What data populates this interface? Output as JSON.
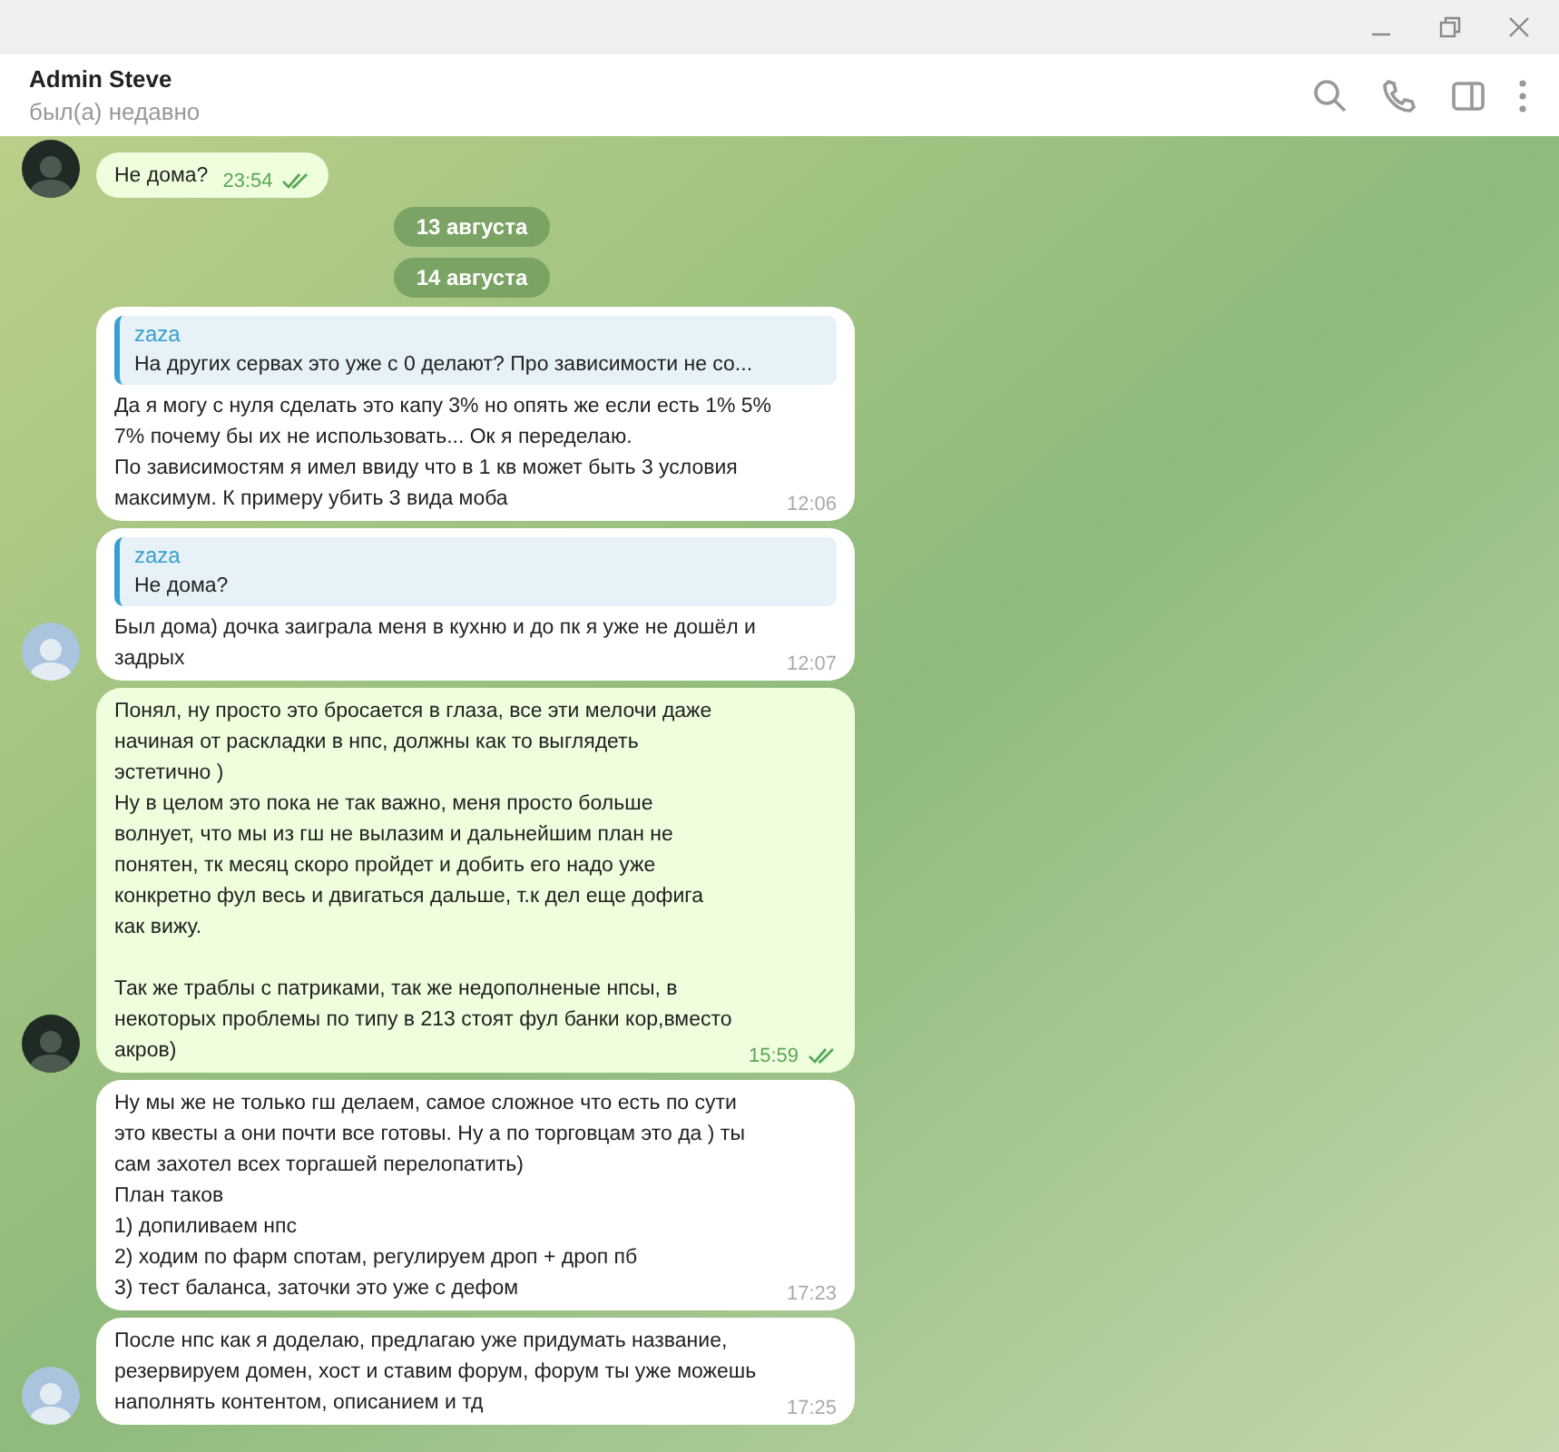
{
  "header": {
    "name": "Admin Steve",
    "status": "был(а) недавно"
  },
  "messages": [
    {
      "kind": "message",
      "outgoing": true,
      "avatar": true,
      "text": "Не дома?",
      "time": "23:54",
      "read": true
    },
    {
      "kind": "date",
      "text": "13 августа"
    },
    {
      "kind": "date",
      "text": "14 августа"
    },
    {
      "kind": "message",
      "outgoing": false,
      "avatar": false,
      "reply": {
        "author": "zaza",
        "text": "На других сервах это уже с 0 делают? Про зависимости не со..."
      },
      "text": "Да я могу с нуля сделать это капу 3% но опять же если есть 1% 5% 7% почему бы их не использовать... Ок я переделаю.\nПо зависимостям я имел ввиду что в 1 кв может быть 3 условия максимум. К примеру убить 3 вида моба",
      "time": "12:06"
    },
    {
      "kind": "message",
      "outgoing": false,
      "avatar": true,
      "reply": {
        "author": "zaza",
        "text": "Не дома?"
      },
      "text": "Был дома) дочка заиграла меня в кухню и до пк я уже не дошёл и задрых",
      "time": "12:07"
    },
    {
      "kind": "message",
      "outgoing": true,
      "avatar": true,
      "text": "Понял, ну просто это бросается в глаза, все эти мелочи даже начиная от раскладки в нпс, должны как то выглядеть эстетично )\nНу в целом это пока не так важно, меня просто больше волнует, что мы из гш не вылазим и дальнейшим план не понятен, тк месяц скоро пройдет и добить его надо уже конкретно фул весь и двигаться дальше, т.к дел еще дофига как вижу.\n\nТак же траблы с патриками, так же недополненые нпсы, в некоторых проблемы по типу в 213 стоят фул банки кор,вместо акров)",
      "time": "15:59",
      "read": true
    },
    {
      "kind": "message",
      "outgoing": false,
      "avatar": false,
      "text": "Ну мы же не только гш делаем, самое сложное что есть по сути это квесты а они почти все готовы. Ну а по торговцам это да ) ты сам захотел всех торгашей перелопатить)\nПлан таков\n1) допиливаем нпс\n2) ходим по фарм спотам, регулируем дроп + дроп пб\n3) тест баланса, заточки это уже с дефом",
      "time": "17:23"
    },
    {
      "kind": "message",
      "outgoing": false,
      "avatar": true,
      "text": "После нпс как я доделаю, предлагаю уже придумать название, резервируем домен, хост и ставим форум, форум ты уже можешь наполнять контентом, описанием и тд",
      "time": "17:25"
    }
  ]
}
